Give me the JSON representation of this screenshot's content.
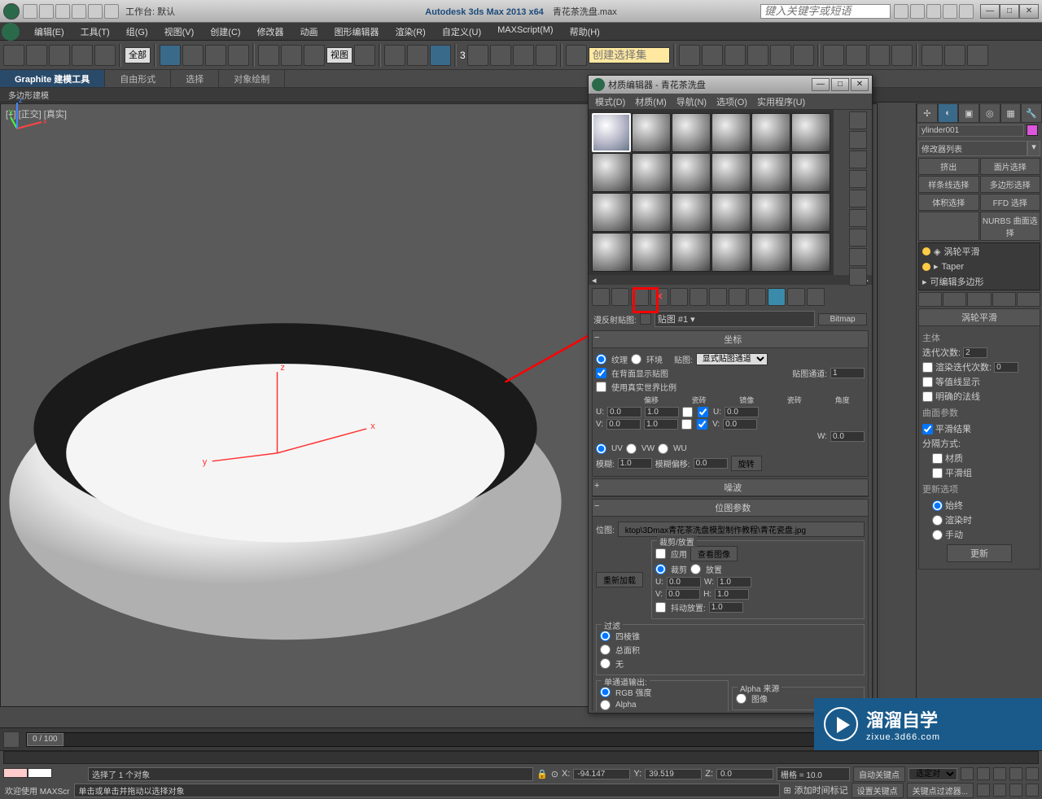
{
  "titlebar": {
    "workspace_label": "工作台: 默认",
    "app": "Autodesk 3ds Max  2013 x64",
    "filename": "青花茶洗盘.max",
    "search_placeholder": "键入关键字或短语"
  },
  "menus": [
    "编辑(E)",
    "工具(T)",
    "组(G)",
    "视图(V)",
    "创建(C)",
    "修改器",
    "动画",
    "图形编辑器",
    "渲染(R)",
    "自定义(U)",
    "MAXScript(M)",
    "帮助(H)"
  ],
  "toolbar": {
    "filter": "全部",
    "refcoord": "视图",
    "selset_placeholder": "创建选择集"
  },
  "ribbon": {
    "tabs": [
      "Graphite 建模工具",
      "自由形式",
      "选择",
      "对象绘制"
    ],
    "sub": "多边形建模"
  },
  "viewport": {
    "label": "[+] [正交] [真实]"
  },
  "cmdpanel": {
    "objname": "ylinder001",
    "modlist_label": "修改器列表",
    "selbuttons": [
      "挤出",
      "面片选择",
      "样条线选择",
      "多边形选择",
      "体积选择",
      "FFD 选择",
      "",
      "NURBS 曲面选择"
    ],
    "stack": [
      "涡轮平滑",
      "Taper",
      "可编辑多边形"
    ],
    "rollout_title": "涡轮平滑",
    "group_main": "主体",
    "iter_label": "迭代次数:",
    "iter_val": "2",
    "render_iter_label": "渲染迭代次数:",
    "render_iter_val": "0",
    "isoline": "等值线显示",
    "normals": "明确的法线",
    "group_surf": "曲面参数",
    "smooth_result": "平滑结果",
    "sep_label": "分隔方式:",
    "material": "材质",
    "smoothgroup": "平滑组",
    "group_update": "更新选项",
    "always": "始终",
    "render": "渲染时",
    "manual": "手动",
    "update_btn": "更新"
  },
  "matedit": {
    "title": "材质编辑器 - 青花茶洗盘",
    "menus": [
      "模式(D)",
      "材质(M)",
      "导航(N)",
      "选项(O)",
      "实用程序(U)"
    ],
    "diffmap_label": "漫反射贴图:",
    "mapname": "贴图 #1",
    "maptype": "Bitmap",
    "coords_title": "坐标",
    "texture": "纹理",
    "environ": "环境",
    "map_label": "贴图:",
    "map_dd": "显式贴图通道",
    "showback": "在背面显示贴图",
    "mapchan_label": "贴图通道:",
    "mapchan_val": "1",
    "realworld": "使用真实世界比例",
    "offset": "偏移",
    "tile": "瓷砖",
    "mirror": "镜像",
    "tile2": "瓷砖",
    "angle": "角度",
    "u": "U:",
    "v": "V:",
    "w": "W:",
    "u_off": "0.0",
    "u_tile": "1.0",
    "u_ang": "0.0",
    "v_off": "0.0",
    "v_tile": "1.0",
    "v_ang": "0.0",
    "w_ang": "0.0",
    "uv": "UV",
    "vw": "VW",
    "wu": "WU",
    "blur_label": "模糊:",
    "blur_val": "1.0",
    "bluroff_label": "模糊偏移:",
    "bluroff_val": "0.0",
    "rotate": "旋转",
    "noise_title": "噪波",
    "bitmapparam_title": "位图参数",
    "bitmap_label": "位图:",
    "bitmap_path": "ktop\\3Dmax青花茶洗盘模型制作教程\\青花瓷盘.jpg",
    "reload": "重新加载",
    "crop_group": "裁剪/放置",
    "apply": "应用",
    "viewimage": "查看图像",
    "crop": "裁剪",
    "place": "放置",
    "cu": "U:",
    "cv": "V:",
    "cw": "W:",
    "ch": "H:",
    "cu_v": "0.0",
    "cv_v": "0.0",
    "cw_v": "1.0",
    "ch_v": "1.0",
    "jitter": "抖动放置:",
    "jitter_v": "1.0",
    "filter_group": "过滤",
    "pyramidal": "四棱锥",
    "sat": "总面积",
    "none": "无",
    "mono_group": "单通道输出:",
    "rgbint": "RGB 强度",
    "alpha": "Alpha",
    "alpha_group": "Alpha 来源",
    "imgalpha": "图像"
  },
  "timeline": {
    "frame": "0 / 100"
  },
  "status": {
    "welcome": "欢迎使用  MAXScr",
    "selected": "选择了 1 个对象",
    "prompt": "单击或单击并拖动以选择对象",
    "x": "X:",
    "xv": "-94.147",
    "y": "Y:",
    "yv": "39.519",
    "z": "Z:",
    "zv": "0.0",
    "grid": "栅格 = 10.0",
    "addtime": "添加时间标记",
    "autokey": "自动关键点",
    "setkey": "设置关键点",
    "seldd": "选定对",
    "keyfilter": "关键点过滤器..."
  },
  "watermark": {
    "big": "溜溜自学",
    "small": "zixue.3d66.com"
  }
}
